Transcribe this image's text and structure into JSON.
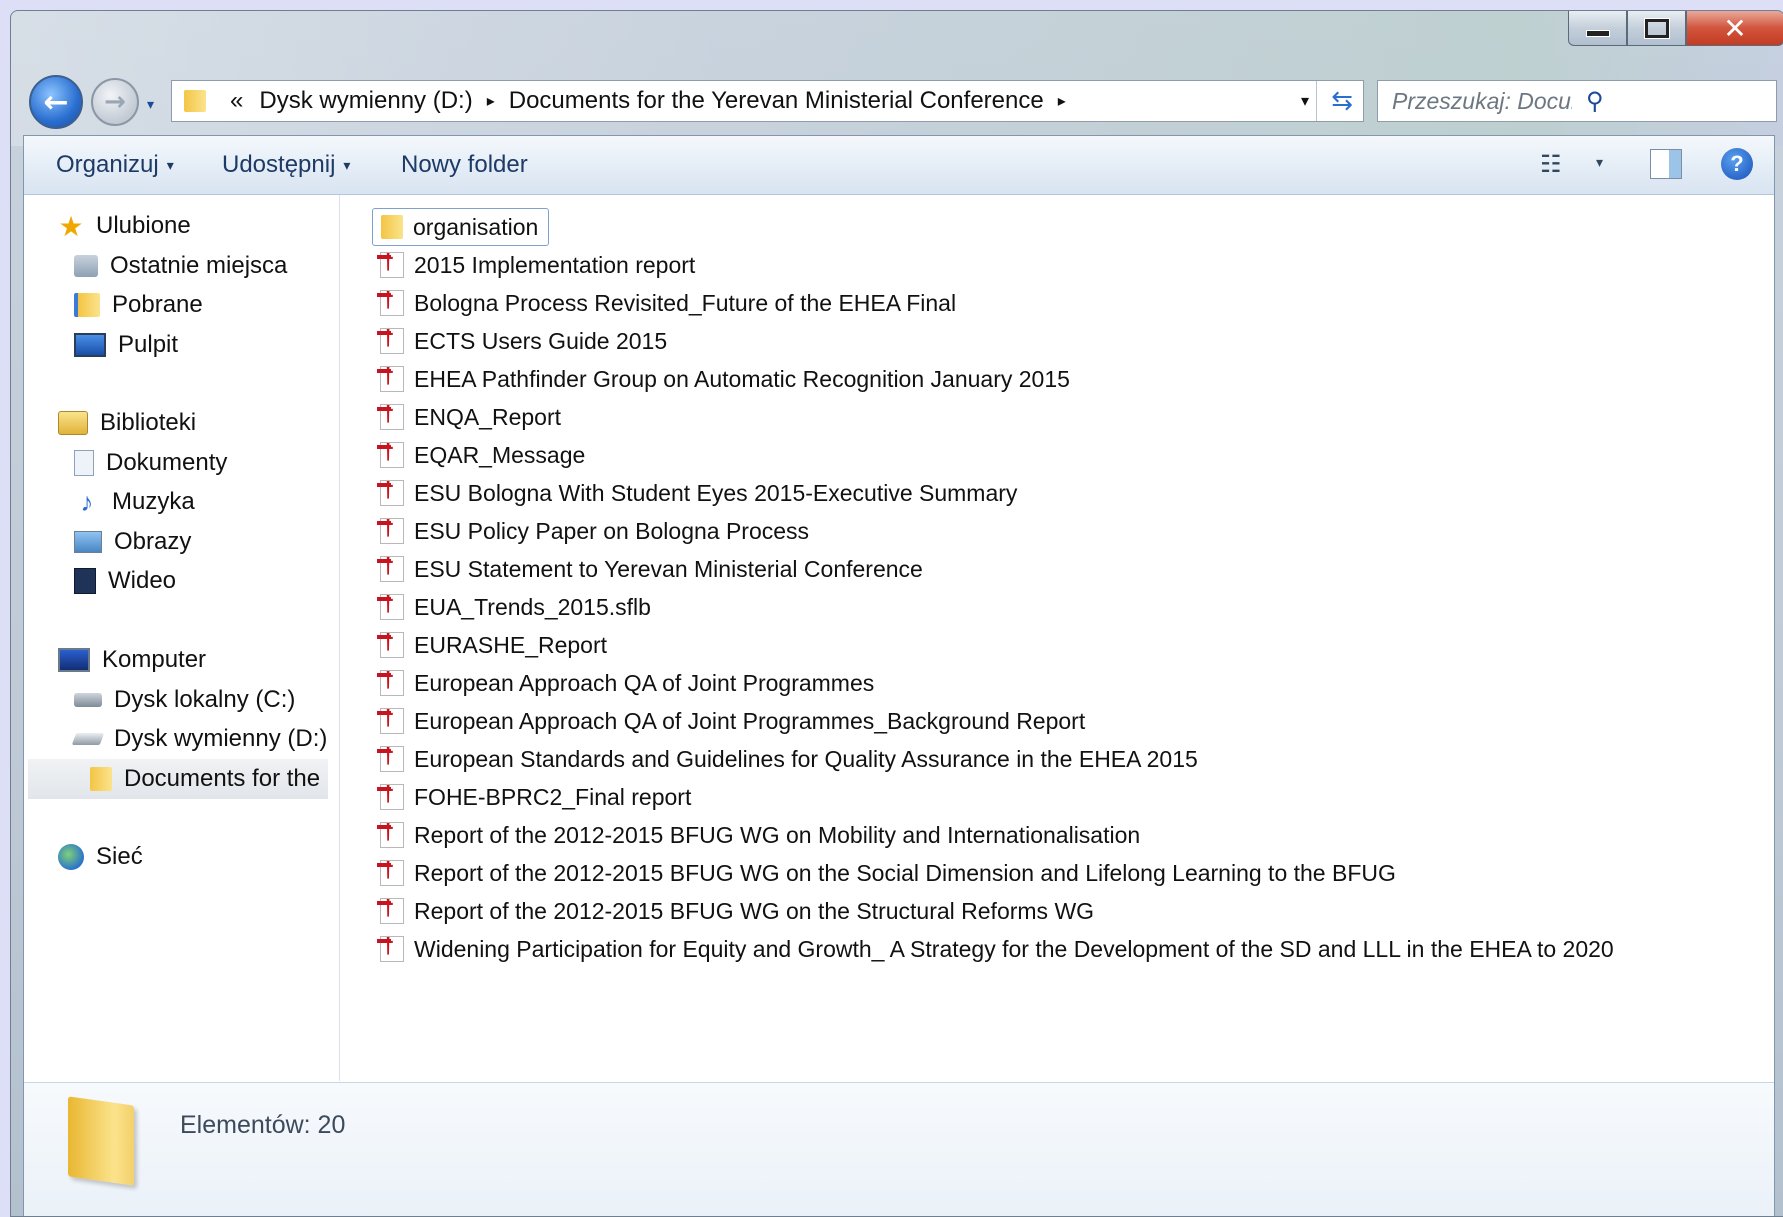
{
  "window": {
    "caption": {
      "minimize": "",
      "maximize": "",
      "close": "✕"
    }
  },
  "navigation": {
    "back_glyph": "←",
    "forward_glyph": "→",
    "history_glyph": "▾"
  },
  "address_bar": {
    "overflow": "«",
    "crumbs": [
      "Dysk wymienny (D:)",
      "Documents for the Yerevan Ministerial Conference"
    ],
    "separator": "▸",
    "dropdown_glyph": "▾",
    "refresh_glyph": "⇆"
  },
  "search": {
    "placeholder": "Przeszukaj: Documents for the...",
    "icon": "⚲"
  },
  "toolbar": {
    "organize": "Organizuj",
    "share": "Udostępnij",
    "new_folder": "Nowy folder",
    "dropdown_glyph": "▾",
    "view_glyph": "☷",
    "help_glyph": "?"
  },
  "sidebar": {
    "favorites": {
      "header": "Ulubione",
      "items": [
        "Ostatnie miejsca",
        "Pobrane",
        "Pulpit"
      ]
    },
    "libraries": {
      "header": "Biblioteki",
      "items": [
        "Dokumenty",
        "Muzyka",
        "Obrazy",
        "Wideo"
      ]
    },
    "computer": {
      "header": "Komputer",
      "items": [
        "Dysk lokalny (C:)",
        "Dysk wymienny (D:)",
        "Documents for the"
      ]
    },
    "network": {
      "header": "Sieć"
    },
    "icons": {
      "star": "★",
      "music": "♪"
    }
  },
  "files": [
    {
      "name": "organisation",
      "type": "folder"
    },
    {
      "name": "2015 Implementation report",
      "type": "pdf"
    },
    {
      "name": "Bologna Process Revisited_Future of the EHEA Final",
      "type": "pdf"
    },
    {
      "name": "ECTS Users Guide 2015",
      "type": "pdf"
    },
    {
      "name": "EHEA Pathfinder Group on Automatic Recognition January 2015",
      "type": "pdf"
    },
    {
      "name": "ENQA_Report",
      "type": "pdf"
    },
    {
      "name": "EQAR_Message",
      "type": "pdf"
    },
    {
      "name": "ESU Bologna With Student Eyes 2015-Executive Summary",
      "type": "pdf"
    },
    {
      "name": "ESU Policy Paper on Bologna Process",
      "type": "pdf"
    },
    {
      "name": "ESU Statement to Yerevan Ministerial Conference",
      "type": "pdf"
    },
    {
      "name": "EUA_Trends_2015.sflb",
      "type": "pdf"
    },
    {
      "name": "EURASHE_Report",
      "type": "pdf"
    },
    {
      "name": "European Approach QA of Joint Programmes",
      "type": "pdf"
    },
    {
      "name": "European Approach QA of Joint Programmes_Background Report",
      "type": "pdf"
    },
    {
      "name": "European Standards and Guidelines for Quality Assurance in the EHEA 2015",
      "type": "pdf"
    },
    {
      "name": "FOHE-BPRC2_Final report",
      "type": "pdf"
    },
    {
      "name": "Report of the 2012-2015 BFUG WG on Mobility and Internationalisation",
      "type": "pdf"
    },
    {
      "name": "Report of the 2012-2015 BFUG WG on the Social Dimension and Lifelong Learning to the BFUG",
      "type": "pdf"
    },
    {
      "name": "Report of the 2012-2015 BFUG WG on the Structural Reforms WG",
      "type": "pdf"
    },
    {
      "name": "Widening Participation for Equity and Growth_ A Strategy for the Development of the SD and LLL in the EHEA to 2020",
      "type": "pdf"
    }
  ],
  "details": {
    "count_text": "Elementów: 20"
  },
  "colors": {
    "link_text": "#1e3a66",
    "pdf_red": "#c8141e",
    "folder_yellow": "#f3c545",
    "close_red": "#c23c22"
  }
}
